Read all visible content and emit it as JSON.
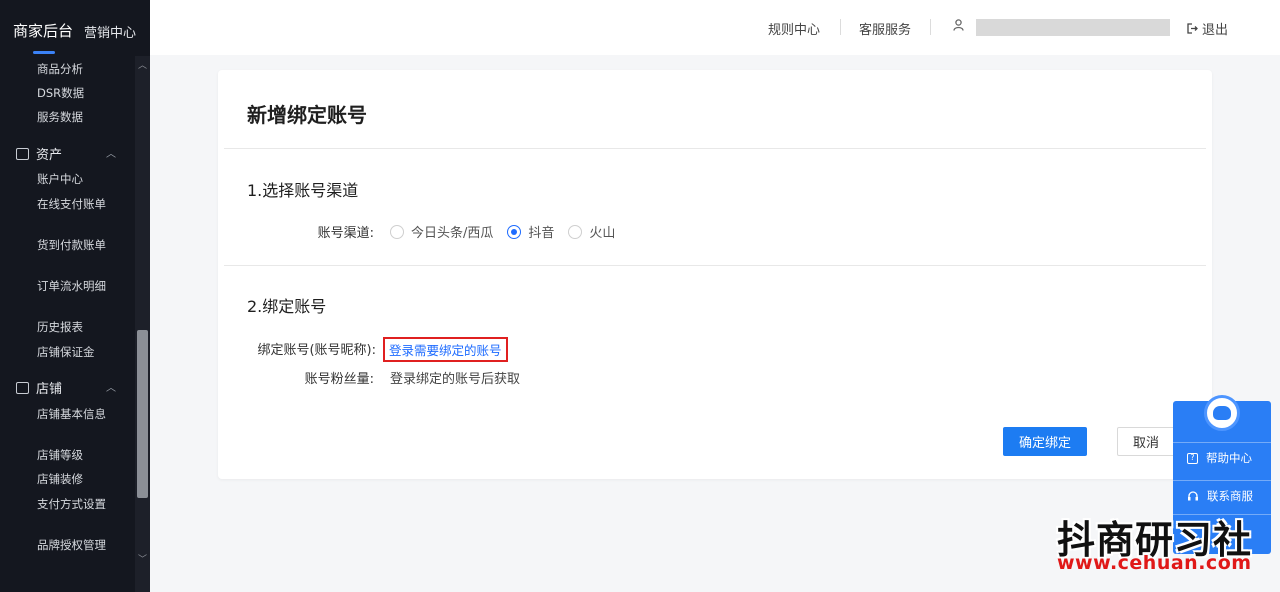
{
  "sidebar": {
    "brand": "商家后台",
    "brand_sub": "营销中心",
    "items_top": [
      "商品分析",
      "DSR数据",
      "服务数据"
    ],
    "group_assets": "资产",
    "assets_items": [
      "账户中心",
      "在线支付账单",
      "货到付款账单",
      "订单流水明细",
      "历史报表",
      "店铺保证金"
    ],
    "group_shop": "店铺",
    "shop_items": [
      "店铺基本信息",
      "店铺等级",
      "店铺装修",
      "支付方式设置",
      "品牌授权管理"
    ]
  },
  "header": {
    "rules": "规则中心",
    "service": "客服服务",
    "logout": "退出"
  },
  "card": {
    "title": "新增绑定账号",
    "section1": "1.选择账号渠道",
    "channel_label": "账号渠道:",
    "channels": [
      {
        "label": "今日头条/西瓜",
        "checked": false
      },
      {
        "label": "抖音",
        "checked": true
      },
      {
        "label": "火山",
        "checked": false
      }
    ],
    "section2": "2.绑定账号",
    "bind_label": "绑定账号(账号昵称):",
    "bind_link": "登录需要绑定的账号",
    "fans_label": "账号粉丝量:",
    "fans_value": "登录绑定的账号后获取",
    "confirm": "确定绑定",
    "cancel": "取消"
  },
  "help": {
    "help_center": "帮助中心",
    "contact": "联系商服"
  },
  "watermark": {
    "title": "抖商研习社",
    "url": "www.cehuan.com"
  }
}
